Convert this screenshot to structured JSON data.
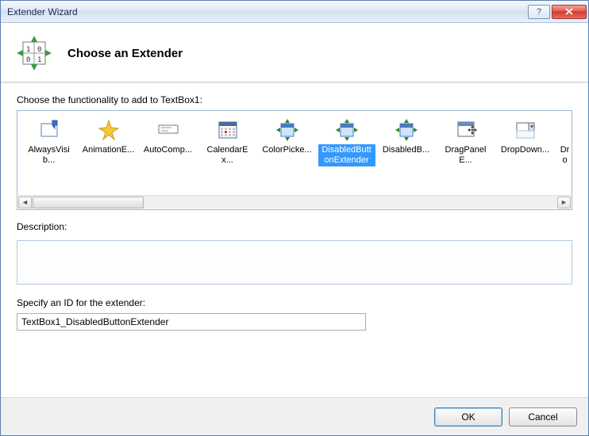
{
  "window": {
    "title": "Extender Wizard"
  },
  "header": {
    "title": "Choose an Extender"
  },
  "functionality": {
    "label": "Choose the functionality to add to TextBox1:",
    "selected_index": 5,
    "items": [
      {
        "label": "AlwaysVisib...",
        "icon": "pin"
      },
      {
        "label": "AnimationE...",
        "icon": "sparkle"
      },
      {
        "label": "AutoComp...",
        "icon": "textfield"
      },
      {
        "label": "CalendarEx...",
        "icon": "calendar"
      },
      {
        "label": "ColorPicke...",
        "icon": "panel-arrows"
      },
      {
        "label": "DisabledButtonExtender",
        "icon": "panel-arrows"
      },
      {
        "label": "DisabledB...",
        "icon": "panel-arrows"
      },
      {
        "label": "DragPanelE...",
        "icon": "panel-move"
      },
      {
        "label": "DropDown...",
        "icon": "dropdown"
      },
      {
        "label": "Dro",
        "icon": "none"
      }
    ]
  },
  "description": {
    "label": "Description:",
    "text": ""
  },
  "id_section": {
    "label": "Specify an ID for the extender:",
    "value": "TextBox1_DisabledButtonExtender"
  },
  "buttons": {
    "ok": "OK",
    "cancel": "Cancel"
  }
}
